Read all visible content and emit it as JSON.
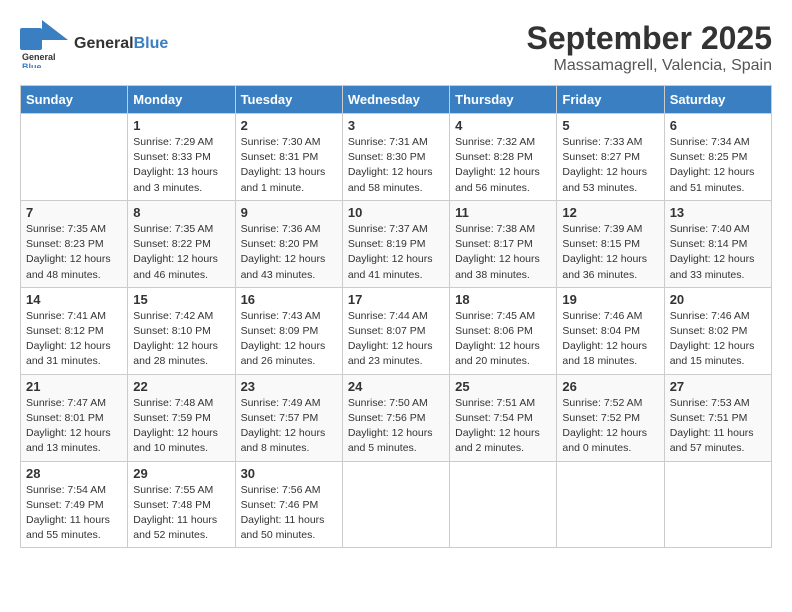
{
  "header": {
    "logo_general": "General",
    "logo_blue": "Blue",
    "title": "September 2025",
    "subtitle": "Massamagrell, Valencia, Spain"
  },
  "columns": [
    "Sunday",
    "Monday",
    "Tuesday",
    "Wednesday",
    "Thursday",
    "Friday",
    "Saturday"
  ],
  "weeks": [
    [
      {
        "day": "",
        "info": ""
      },
      {
        "day": "1",
        "info": "Sunrise: 7:29 AM\nSunset: 8:33 PM\nDaylight: 13 hours\nand 3 minutes."
      },
      {
        "day": "2",
        "info": "Sunrise: 7:30 AM\nSunset: 8:31 PM\nDaylight: 13 hours\nand 1 minute."
      },
      {
        "day": "3",
        "info": "Sunrise: 7:31 AM\nSunset: 8:30 PM\nDaylight: 12 hours\nand 58 minutes."
      },
      {
        "day": "4",
        "info": "Sunrise: 7:32 AM\nSunset: 8:28 PM\nDaylight: 12 hours\nand 56 minutes."
      },
      {
        "day": "5",
        "info": "Sunrise: 7:33 AM\nSunset: 8:27 PM\nDaylight: 12 hours\nand 53 minutes."
      },
      {
        "day": "6",
        "info": "Sunrise: 7:34 AM\nSunset: 8:25 PM\nDaylight: 12 hours\nand 51 minutes."
      }
    ],
    [
      {
        "day": "7",
        "info": "Sunrise: 7:35 AM\nSunset: 8:23 PM\nDaylight: 12 hours\nand 48 minutes."
      },
      {
        "day": "8",
        "info": "Sunrise: 7:35 AM\nSunset: 8:22 PM\nDaylight: 12 hours\nand 46 minutes."
      },
      {
        "day": "9",
        "info": "Sunrise: 7:36 AM\nSunset: 8:20 PM\nDaylight: 12 hours\nand 43 minutes."
      },
      {
        "day": "10",
        "info": "Sunrise: 7:37 AM\nSunset: 8:19 PM\nDaylight: 12 hours\nand 41 minutes."
      },
      {
        "day": "11",
        "info": "Sunrise: 7:38 AM\nSunset: 8:17 PM\nDaylight: 12 hours\nand 38 minutes."
      },
      {
        "day": "12",
        "info": "Sunrise: 7:39 AM\nSunset: 8:15 PM\nDaylight: 12 hours\nand 36 minutes."
      },
      {
        "day": "13",
        "info": "Sunrise: 7:40 AM\nSunset: 8:14 PM\nDaylight: 12 hours\nand 33 minutes."
      }
    ],
    [
      {
        "day": "14",
        "info": "Sunrise: 7:41 AM\nSunset: 8:12 PM\nDaylight: 12 hours\nand 31 minutes."
      },
      {
        "day": "15",
        "info": "Sunrise: 7:42 AM\nSunset: 8:10 PM\nDaylight: 12 hours\nand 28 minutes."
      },
      {
        "day": "16",
        "info": "Sunrise: 7:43 AM\nSunset: 8:09 PM\nDaylight: 12 hours\nand 26 minutes."
      },
      {
        "day": "17",
        "info": "Sunrise: 7:44 AM\nSunset: 8:07 PM\nDaylight: 12 hours\nand 23 minutes."
      },
      {
        "day": "18",
        "info": "Sunrise: 7:45 AM\nSunset: 8:06 PM\nDaylight: 12 hours\nand 20 minutes."
      },
      {
        "day": "19",
        "info": "Sunrise: 7:46 AM\nSunset: 8:04 PM\nDaylight: 12 hours\nand 18 minutes."
      },
      {
        "day": "20",
        "info": "Sunrise: 7:46 AM\nSunset: 8:02 PM\nDaylight: 12 hours\nand 15 minutes."
      }
    ],
    [
      {
        "day": "21",
        "info": "Sunrise: 7:47 AM\nSunset: 8:01 PM\nDaylight: 12 hours\nand 13 minutes."
      },
      {
        "day": "22",
        "info": "Sunrise: 7:48 AM\nSunset: 7:59 PM\nDaylight: 12 hours\nand 10 minutes."
      },
      {
        "day": "23",
        "info": "Sunrise: 7:49 AM\nSunset: 7:57 PM\nDaylight: 12 hours\nand 8 minutes."
      },
      {
        "day": "24",
        "info": "Sunrise: 7:50 AM\nSunset: 7:56 PM\nDaylight: 12 hours\nand 5 minutes."
      },
      {
        "day": "25",
        "info": "Sunrise: 7:51 AM\nSunset: 7:54 PM\nDaylight: 12 hours\nand 2 minutes."
      },
      {
        "day": "26",
        "info": "Sunrise: 7:52 AM\nSunset: 7:52 PM\nDaylight: 12 hours\nand 0 minutes."
      },
      {
        "day": "27",
        "info": "Sunrise: 7:53 AM\nSunset: 7:51 PM\nDaylight: 11 hours\nand 57 minutes."
      }
    ],
    [
      {
        "day": "28",
        "info": "Sunrise: 7:54 AM\nSunset: 7:49 PM\nDaylight: 11 hours\nand 55 minutes."
      },
      {
        "day": "29",
        "info": "Sunrise: 7:55 AM\nSunset: 7:48 PM\nDaylight: 11 hours\nand 52 minutes."
      },
      {
        "day": "30",
        "info": "Sunrise: 7:56 AM\nSunset: 7:46 PM\nDaylight: 11 hours\nand 50 minutes."
      },
      {
        "day": "",
        "info": ""
      },
      {
        "day": "",
        "info": ""
      },
      {
        "day": "",
        "info": ""
      },
      {
        "day": "",
        "info": ""
      }
    ]
  ]
}
